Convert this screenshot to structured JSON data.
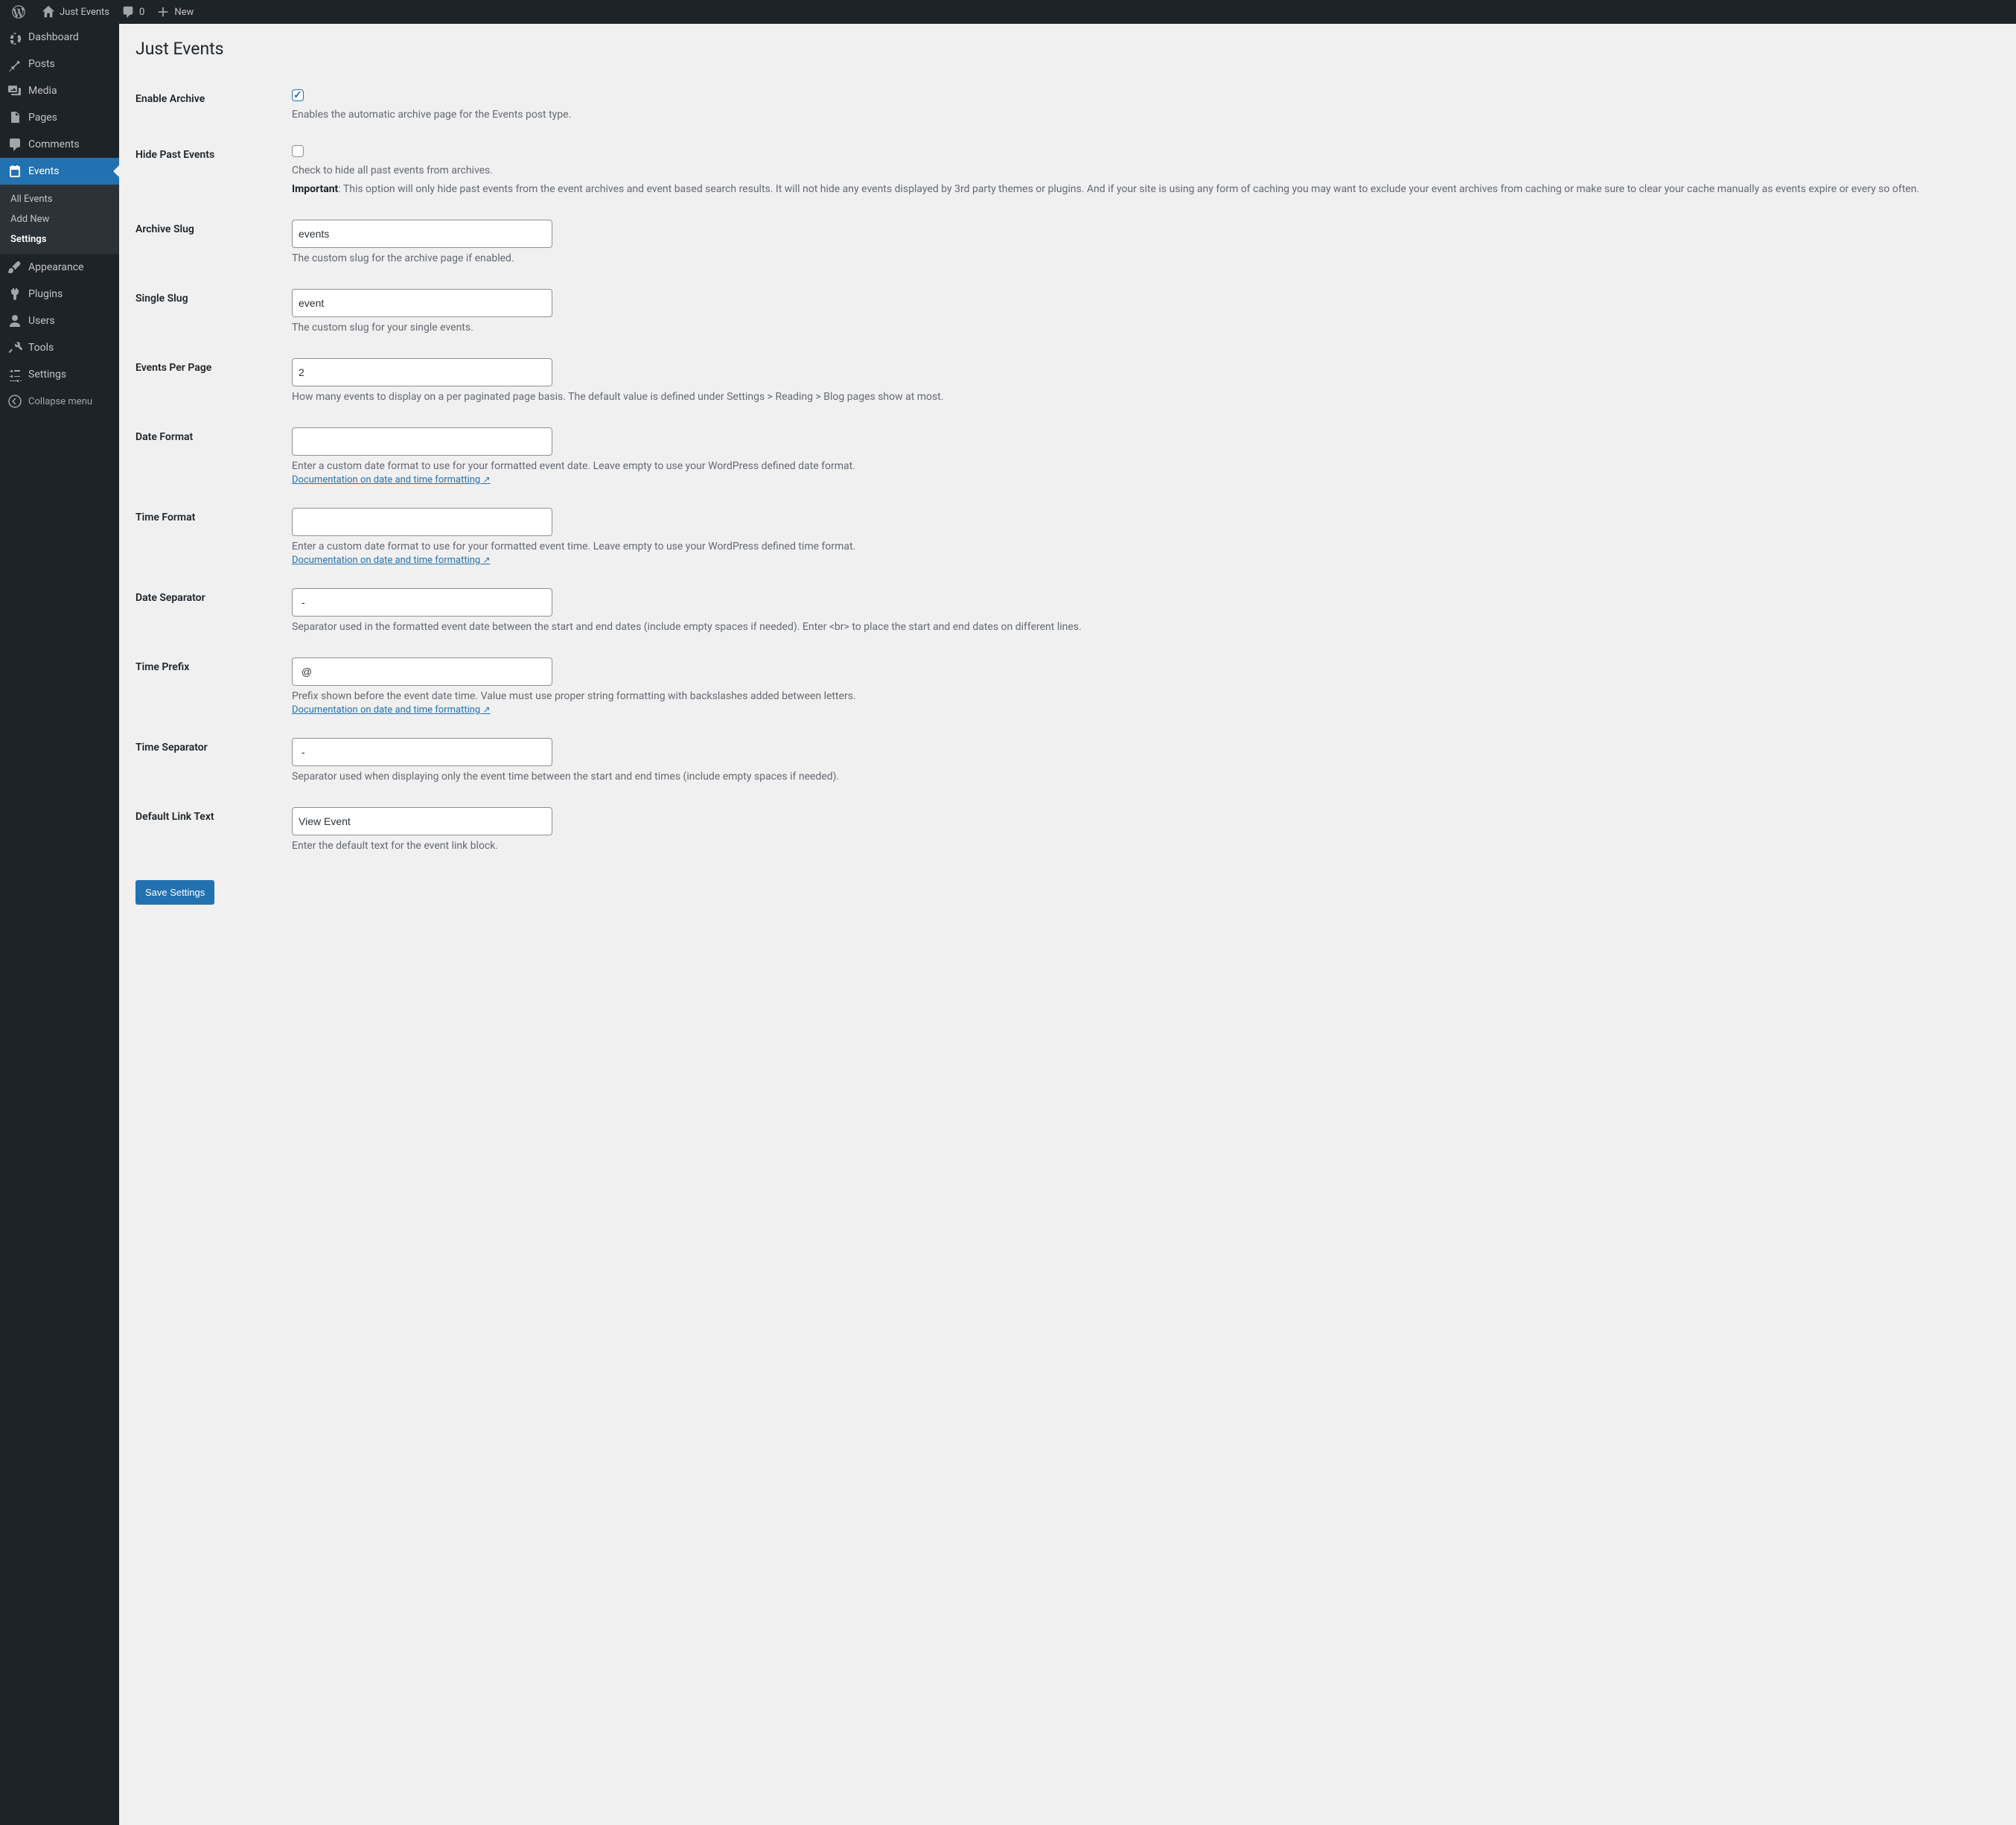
{
  "adminbar": {
    "site_name": "Just Events",
    "comments_count": "0",
    "new_label": "New"
  },
  "sidebar": {
    "items": [
      {
        "id": "dashboard",
        "label": "Dashboard"
      },
      {
        "id": "posts",
        "label": "Posts"
      },
      {
        "id": "media",
        "label": "Media"
      },
      {
        "id": "pages",
        "label": "Pages"
      },
      {
        "id": "comments",
        "label": "Comments"
      },
      {
        "id": "events",
        "label": "Events"
      },
      {
        "id": "appearance",
        "label": "Appearance"
      },
      {
        "id": "plugins",
        "label": "Plugins"
      },
      {
        "id": "users",
        "label": "Users"
      },
      {
        "id": "tools",
        "label": "Tools"
      },
      {
        "id": "settings",
        "label": "Settings"
      }
    ],
    "events_submenu": [
      {
        "label": "All Events"
      },
      {
        "label": "Add New"
      },
      {
        "label": "Settings"
      }
    ],
    "collapse_label": "Collapse menu"
  },
  "page": {
    "title": "Just Events",
    "fields": {
      "enable_archive": {
        "label": "Enable Archive",
        "checked": true,
        "description": "Enables the automatic archive page for the Events post type."
      },
      "hide_past": {
        "label": "Hide Past Events",
        "checked": false,
        "description": "Check to hide all past events from archives.",
        "important_label": "Important",
        "important_text": ": This option will only hide past events from the event archives and event based search results. It will not hide any events displayed by 3rd party themes or plugins. And if your site is using any form of caching you may want to exclude your event archives from caching or make sure to clear your cache manually as events expire or every so often."
      },
      "archive_slug": {
        "label": "Archive Slug",
        "value": "events",
        "description": "The custom slug for the archive page if enabled."
      },
      "single_slug": {
        "label": "Single Slug",
        "value": "event",
        "description": "The custom slug for your single events."
      },
      "per_page": {
        "label": "Events Per Page",
        "value": "2",
        "description": "How many events to display on a per paginated page basis. The default value is defined under Settings > Reading > Blog pages show at most."
      },
      "date_format": {
        "label": "Date Format",
        "value": "",
        "description": "Enter a custom date format to use for your formatted event date. Leave empty to use your WordPress defined date format.",
        "doc_link": "Documentation on date and time formatting"
      },
      "time_format": {
        "label": "Time Format",
        "value": "",
        "description": "Enter a custom date format to use for your formatted event time. Leave empty to use your WordPress defined time format.",
        "doc_link": "Documentation on date and time formatting"
      },
      "date_separator": {
        "label": "Date Separator",
        "value": " - ",
        "description": "Separator used in the formatted event date between the start and end dates (include empty spaces if needed). Enter <br> to place the start and end dates on different lines."
      },
      "time_prefix": {
        "label": "Time Prefix",
        "value": " @ ",
        "description": "Prefix shown before the event date time. Value must use proper string formatting with backslashes added between letters.",
        "doc_link": "Documentation on date and time formatting"
      },
      "time_separator": {
        "label": "Time Separator",
        "value": " - ",
        "description": "Separator used when displaying only the event time between the start and end times (include empty spaces if needed)."
      },
      "default_link_text": {
        "label": "Default Link Text",
        "value": "View Event",
        "description": "Enter the default text for the event link block."
      }
    },
    "submit_label": "Save Settings"
  }
}
